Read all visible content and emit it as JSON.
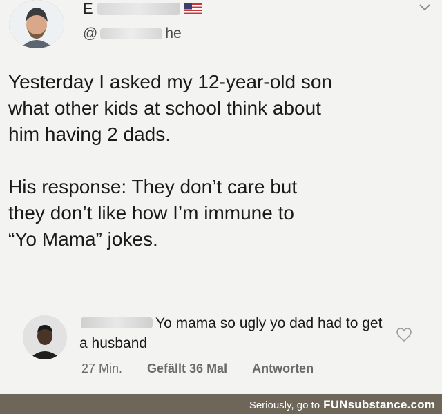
{
  "post": {
    "author_name_visible": "E",
    "handle_prefix": "@",
    "handle_suffix": "he",
    "body_paragraphs": [
      "Yesterday I asked my 12-year-old son\nwhat other kids at school think about\nhim having 2 dads.",
      "His response: They don’t care but\nthey don’t like how I’m immune to\n“Yo Mama” jokes."
    ],
    "icons": {
      "avatar": "profile-photo",
      "flag": "us-flag-icon",
      "menu": "chevron-down-icon"
    },
    "ring_colors": [
      "#e6c02e",
      "#6a56c7"
    ]
  },
  "comment": {
    "text": "Yo mama so ugly yo dad had to get a husband",
    "time": "27 Min.",
    "likes": "Gefällt 36 Mal",
    "reply": "Antworten",
    "icons": {
      "avatar": "commenter-photo",
      "like": "heart-icon"
    }
  },
  "footer": {
    "prefix": "Seriously, go to",
    "site": "FUNsubstance.com",
    "background": "#6f665a"
  }
}
